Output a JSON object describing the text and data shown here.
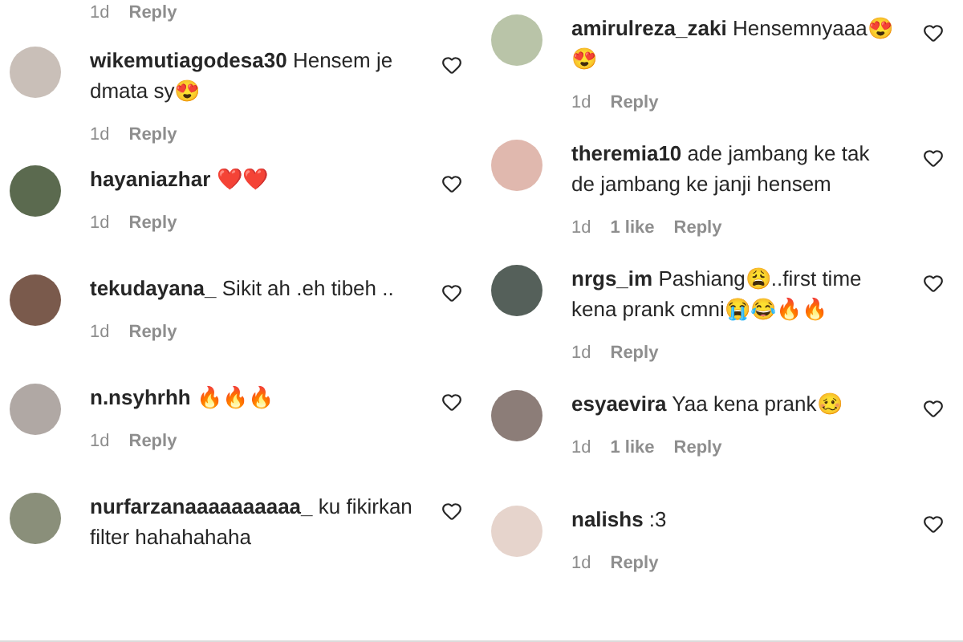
{
  "columns": [
    {
      "top_meta": {
        "time": "1d",
        "reply": "Reply"
      },
      "comments": [
        {
          "username": "wikemutiagodesa30",
          "text": "Hensem je dmata sy😍",
          "time": "1d",
          "reply": "Reply",
          "liked": false
        },
        {
          "username": "hayaniazhar",
          "text": "❤️❤️",
          "time": "1d",
          "reply": "Reply",
          "liked": false
        },
        {
          "username": "tekudayana_",
          "text": "Sikit ah .eh tibeh ..",
          "time": "1d",
          "reply": "Reply",
          "liked": false
        },
        {
          "username": "n.nsyhrhh",
          "text": "🔥🔥🔥",
          "time": "1d",
          "reply": "Reply",
          "liked": false
        },
        {
          "username": "nurfarzanaaaaaaaaaa_",
          "text": "ku fikirkan filter hahahahaha",
          "liked": false
        }
      ]
    },
    {
      "comments": [
        {
          "username": "amirulreza_zaki",
          "text": "Hensemnyaaa😍😍",
          "time": "1d",
          "reply": "Reply",
          "liked": false
        },
        {
          "username": "theremia10",
          "text": "ade jambang ke tak de jambang ke janji hensem",
          "time": "1d",
          "likes": "1 like",
          "reply": "Reply",
          "liked": false
        },
        {
          "username": "nrgs_im",
          "text": "Pashiang😩..first time kena prank cmni😭😂🔥🔥",
          "time": "1d",
          "reply": "Reply",
          "liked": false
        },
        {
          "username": "esyaevira",
          "text": "Yaa kena prank🥴",
          "time": "1d",
          "likes": "1 like",
          "reply": "Reply",
          "liked": false
        },
        {
          "username": "nalishs",
          "text": ":3",
          "time": "1d",
          "reply": "Reply",
          "liked": false
        }
      ]
    }
  ]
}
